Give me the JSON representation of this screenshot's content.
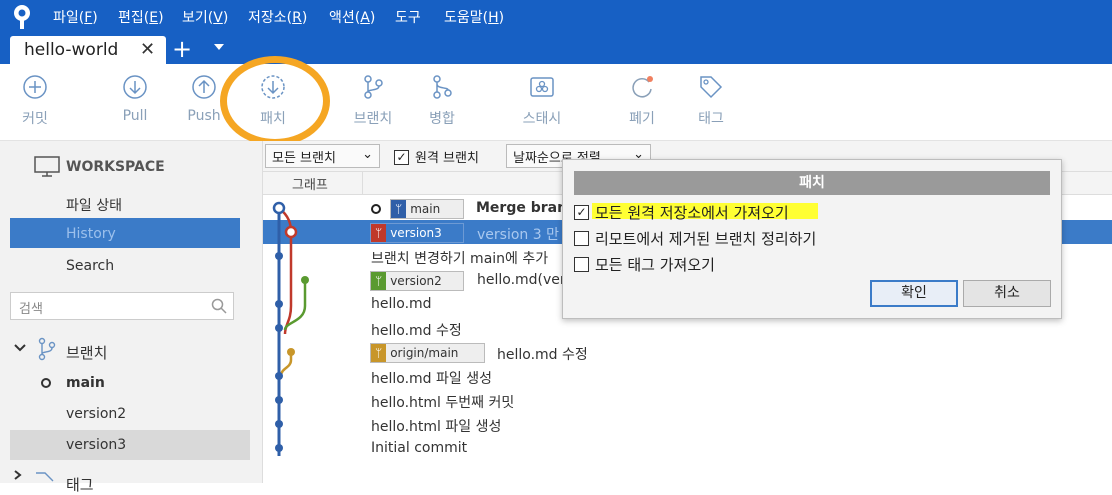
{
  "menu": [
    {
      "label": "파일(",
      "key": "F",
      "end": ")"
    },
    {
      "label": "편집(",
      "key": "E",
      "end": ")"
    },
    {
      "label": "보기(",
      "key": "V",
      "end": ")"
    },
    {
      "label": "저장소(",
      "key": "R",
      "end": ")"
    },
    {
      "label": "액션(",
      "key": "A",
      "end": ")"
    },
    {
      "label": "도구",
      "key": "",
      "end": ""
    },
    {
      "label": "도움말(",
      "key": "H",
      "end": ")"
    }
  ],
  "tab": {
    "title": "hello-world",
    "close": "✕",
    "add": "+"
  },
  "toolbar": {
    "commit": "커밋",
    "pull": "Pull",
    "push": "Push",
    "fetch": "패치",
    "branch": "브랜치",
    "merge": "병합",
    "stash": "스태시",
    "discard": "폐기",
    "tag": "태그"
  },
  "sidebar": {
    "workspace": "WORKSPACE",
    "file_status": "파일 상태",
    "history": "History",
    "search": "Search",
    "search_placeholder": "검색",
    "branches": "브랜치",
    "branch_items": [
      "main",
      "version2",
      "version3"
    ],
    "tags": "태그"
  },
  "filters": {
    "all_branches": "모든 브랜치",
    "remote_branches": "원격 브랜치",
    "sort": "날짜순으로 정렬"
  },
  "columns": {
    "graph": "그래프"
  },
  "commits": [
    {
      "badge": "main",
      "message": "Merge branc"
    },
    {
      "badge": "version3",
      "message": "version 3 만"
    },
    {
      "badge": "",
      "message": "브랜치 변경하기 main에 추가"
    },
    {
      "badge": "version2",
      "message": "hello.md(ver"
    },
    {
      "badge": "",
      "message": "hello.md"
    },
    {
      "badge": "",
      "message": "hello.md 수정"
    },
    {
      "badge": "origin/main",
      "message": "hello.md 수정"
    },
    {
      "badge": "",
      "message": "hello.md 파일 생성"
    },
    {
      "badge": "",
      "message": "hello.html 두번째 커밋"
    },
    {
      "badge": "",
      "message": "hello.html 파일 생성"
    },
    {
      "badge": "",
      "message": "Initial commit"
    }
  ],
  "dialog": {
    "title": "패치",
    "options": [
      {
        "label": "모든 원격 저장소에서 가져오기",
        "checked": true
      },
      {
        "label": "리모트에서 제거된 브랜치 정리하기",
        "checked": false
      },
      {
        "label": "모든 태그 가져오기",
        "checked": false
      }
    ],
    "ok": "확인",
    "cancel": "취소"
  },
  "colors": {
    "accent": "#1760c4",
    "selection": "#3b7bc8",
    "fetch_highlight": "#f5a623",
    "text_highlight": "#ffff33"
  }
}
